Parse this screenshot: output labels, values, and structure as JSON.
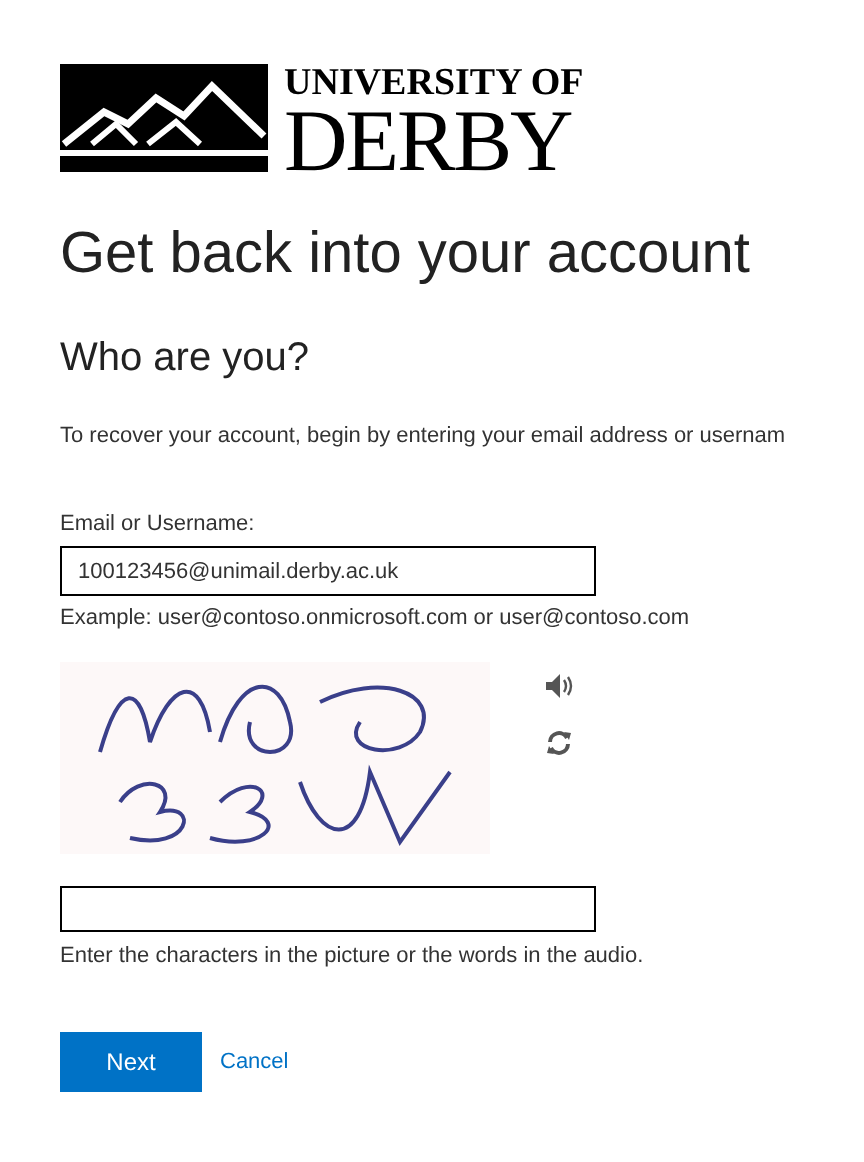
{
  "logo": {
    "line_1": "UNIVERSITY OF",
    "line_2": "DERBY"
  },
  "title": "Get back into your account",
  "subtitle": "Who are you?",
  "intro": "To recover your account, begin by entering your email address or usernam",
  "email": {
    "label": "Email or Username:",
    "value": "100123456@unimail.derby.ac.uk",
    "example": "Example: user@contoso.onmicrosoft.com or user@contoso.com"
  },
  "captcha": {
    "kind": "picture",
    "hint": "Enter the characters in the picture or the words in the audio."
  },
  "buttons": {
    "next": "Next",
    "cancel": "Cancel"
  }
}
